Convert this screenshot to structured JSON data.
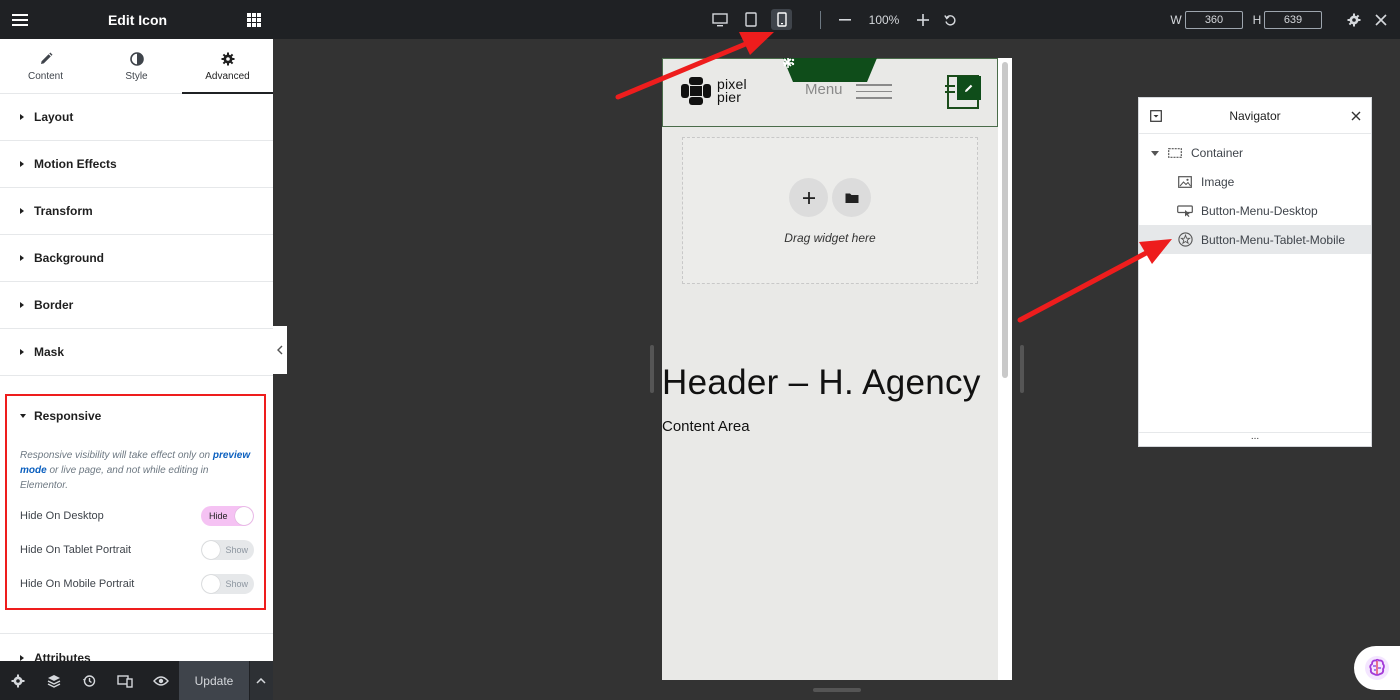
{
  "panel": {
    "title": "Edit Icon",
    "tabs": [
      {
        "label": "Content"
      },
      {
        "label": "Style"
      },
      {
        "label": "Advanced"
      }
    ],
    "sections": [
      {
        "label": "Layout"
      },
      {
        "label": "Motion Effects"
      },
      {
        "label": "Transform"
      },
      {
        "label": "Background"
      },
      {
        "label": "Border"
      },
      {
        "label": "Mask"
      }
    ],
    "responsive": {
      "title": "Responsive",
      "note_pre": "Responsive visibility will take effect only on ",
      "note_link": "preview mode",
      "note_post": " or live page, and not while editing in Elementor.",
      "rows": [
        {
          "label": "Hide On Desktop",
          "toggle": "Hide",
          "on": true
        },
        {
          "label": "Hide On Tablet Portrait",
          "toggle": "Show",
          "on": false
        },
        {
          "label": "Hide On Mobile Portrait",
          "toggle": "Show",
          "on": false
        }
      ]
    },
    "attributes_label": "Attributes",
    "footer": {
      "update_label": "Update"
    }
  },
  "topbar": {
    "zoom": "100%",
    "width_label": "W",
    "width_value": "360",
    "height_label": "H",
    "height_value": "639",
    "active_device": "mobile"
  },
  "canvas": {
    "logo_line1": "pixel",
    "logo_line2": "pier",
    "menu_label": "Menu",
    "dropzone_text": "Drag widget here",
    "heading": "Header – H. Agency",
    "content": "Content Area"
  },
  "navigator": {
    "title": "Navigator",
    "items": [
      {
        "label": "Container",
        "icon": "container-icon"
      },
      {
        "label": "Image",
        "icon": "image-icon"
      },
      {
        "label": "Button-Menu-Desktop",
        "icon": "button-icon"
      },
      {
        "label": "Button-Menu-Tablet-Mobile",
        "icon": "star-icon",
        "selected": true
      }
    ],
    "footer": "..."
  },
  "colors": {
    "dark_bar": "#1f2124",
    "canvas_bg": "#333333",
    "highlight_red": "#ee1d1d",
    "toggle_on": "#f5c2f3",
    "link_blue": "#0c60bf",
    "brand_green": "#0f4d1a"
  }
}
